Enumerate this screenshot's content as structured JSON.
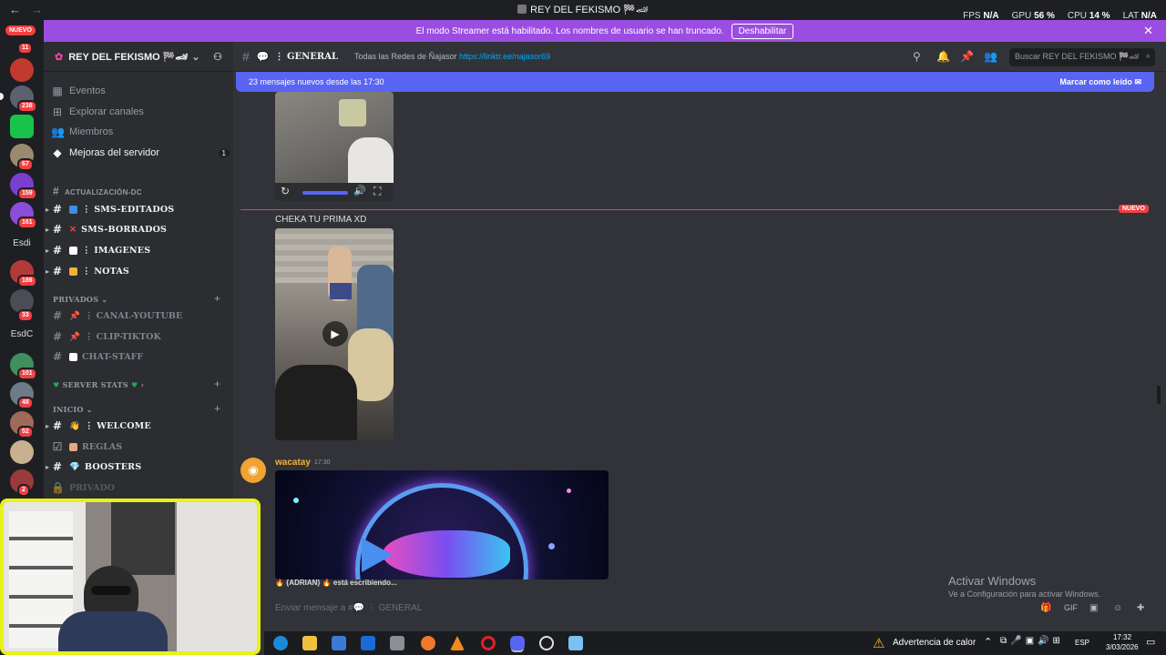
{
  "window": {
    "title": "REY DEL FEKISMO 🏁🏎",
    "perf": {
      "fps_label": "FPS",
      "fps": "N/A",
      "gpu_label": "GPU",
      "gpu": "56 %",
      "cpu_label": "CPU",
      "cpu": "14 %",
      "lat_label": "LAT",
      "lat": "N/A"
    }
  },
  "banner": {
    "text": "El modo Streamer está habilitado. Los nombres de usuario se han truncado.",
    "button": "Deshabilitar"
  },
  "rail": {
    "new_label": "NUEVO",
    "badges": [
      "11",
      "238",
      "67",
      "159",
      "161",
      "186",
      "33",
      "101",
      "48",
      "52",
      "2"
    ],
    "text_servers": [
      "Esdi",
      "EsdC"
    ]
  },
  "server": {
    "name": "REY DEL FEKISMO 🏁🏎",
    "menu": [
      {
        "label": "Eventos",
        "icon": "calendar-icon"
      },
      {
        "label": "Explorar canales",
        "icon": "compass-icon"
      },
      {
        "label": "Miembros",
        "icon": "members-icon"
      },
      {
        "label": "Mejoras del servidor",
        "icon": "boost-icon",
        "count": "1"
      }
    ],
    "categories": {
      "actualizacion": "ACTUALIZACIÓN-DC",
      "privados": "PRIVADOS",
      "server_stats": "SERVER STATS",
      "inicio": "INICIO"
    },
    "channels_actualizacion": [
      {
        "label": "⋮ SMS-EDITADOS",
        "color": "#3b8eea"
      },
      {
        "label": "SMS-BORRADOS",
        "color": "#f23f42"
      },
      {
        "label": "⋮ IMAGENES",
        "color": "#ffffff"
      },
      {
        "label": "⋮ NOTAS",
        "color": "#f0b232"
      }
    ],
    "channels_privados": [
      {
        "label": "⋮ CANAL-YOUTUBE",
        "color": "#f23f42"
      },
      {
        "label": "⋮ CLIP-TIKTOK",
        "color": "#f23f42"
      },
      {
        "label": "CHAT-STAFF",
        "color": "#ffffff"
      }
    ],
    "channels_inicio": [
      {
        "label": "⋮ WELCOME",
        "color": "#f0b232",
        "active": true
      },
      {
        "label": "REGLAS",
        "color": "#e8a87c",
        "active": false
      },
      {
        "label": "BOOSTERS",
        "color": "#3bc4f2",
        "active": true
      },
      {
        "label": "PRIVADO",
        "color": "#888888",
        "active": false
      }
    ]
  },
  "chat": {
    "channel": "⋮ GENERAL",
    "topic": "Todas las Redes de Ñajasor",
    "topic_link": "https://linktr.ee/najasor69",
    "search_placeholder": "Buscar REY DEL FEKISMO 🏁🏎",
    "new_messages": "23 mensajes nuevos desde las 17:30",
    "mark_read": "Marcar como leído",
    "new_tag": "NUEVO",
    "message1_text": "CHEKA TU PRIMA XD",
    "message2_author": "wacatay",
    "message2_time": "17:30",
    "typing": "🔥 {ADRIAN} 🔥 está escribiendo...",
    "input_placeholder": "Enviar mensaje a #💬 ⋮ GENERAL"
  },
  "overlay": {
    "activate_title": "Activar Windows",
    "activate_sub": "Ve a Configuración para activar Windows."
  },
  "taskbar": {
    "warning": "Advertencia de calor",
    "lang": "ESP",
    "time": "17:32",
    "date": "3/03/2026"
  },
  "colors": {
    "accent": "#5865f2",
    "banner": "#9b4de2",
    "new": "#f23f42",
    "webcam_border": "#e6f21a"
  }
}
